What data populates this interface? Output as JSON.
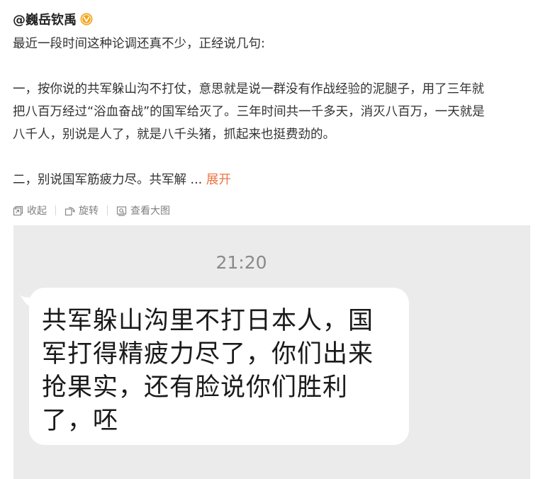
{
  "author": {
    "name": "@巍岳钦禹",
    "badge_icon": "verified-badge-icon",
    "badge_color": "#f2a31a"
  },
  "post": {
    "lines": [
      "最近一段时间这种论调还真不少，正经说几句:",
      "",
      "一，按你说的共军躲山沟不打仗，意思就是说一群没有作战经验的泥腿子，用了三年就",
      "把八百万经过“浴血奋战”的国军给灭了。三年时间共一千多天，消灭八百万，一天就是",
      "八千人，别说是人了，就是八千头猪，抓起来也挺费劲的。",
      "",
      "二，别说国军筋疲力尽。共军解  ..."
    ],
    "expand_label": "展开",
    "expand_color": "#eb7340"
  },
  "toolbar": {
    "collapse_label": "收起",
    "rotate_label": "旋转",
    "view_large_label": "查看大图"
  },
  "image": {
    "time": "21:20",
    "bubble_lines": [
      "共军躲山沟里不打日本人，国",
      "军打得精疲力尽了，你们出来",
      "抢果实，还有脸说你们胜利",
      "了，呸"
    ]
  }
}
